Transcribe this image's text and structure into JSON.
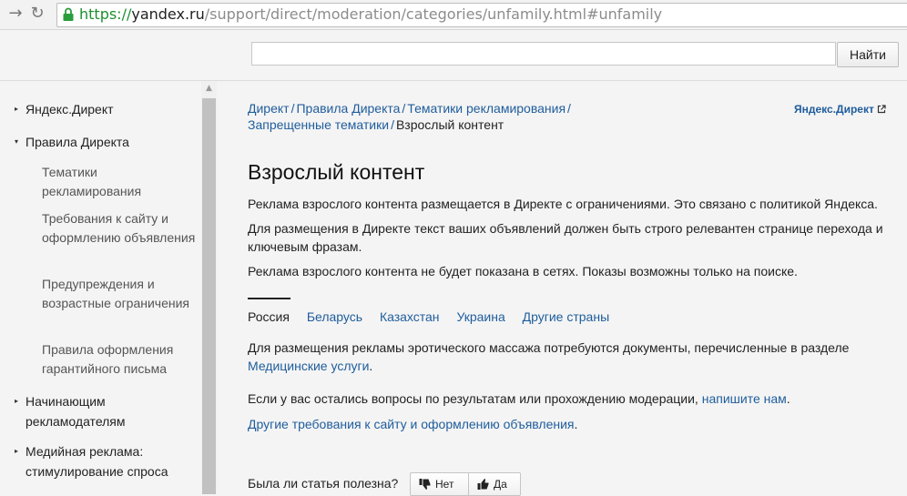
{
  "browser": {
    "url_scheme": "https://",
    "url_host": "yandex.ru",
    "url_path": "/support/direct/moderation/categories/unfamily.html#unfamily"
  },
  "search": {
    "button_label": "Найти",
    "value": ""
  },
  "sidebar": {
    "items": [
      {
        "label": "Яндекс.Директ",
        "expanded": false
      },
      {
        "label": "Правила Директа",
        "expanded": true
      },
      {
        "label": "Начинающим рекламодателям",
        "expanded": false
      },
      {
        "label": "Медийная реклама: стимулирование спроса",
        "expanded": false
      }
    ],
    "subitems": [
      "Тематики рекламирования",
      "Требования к сайту и оформлению объявления",
      "Предупреждения и возрастные ограничения",
      "Правила оформления гарантийного письма"
    ]
  },
  "breadcrumbs": {
    "links": [
      "Директ",
      "Правила Директа",
      "Тематики рекламирования",
      "Запрещенные тематики"
    ],
    "separator": "/",
    "current": "Взрослый контент"
  },
  "header_link": "Яндекс.Директ",
  "article": {
    "title": "Взрослый контент",
    "p1": "Реклама взрослого контента размещается в Директе с ограничениями. Это связано с политикой Яндекса.",
    "p2": "Для размещения в Директе текст ваших объявлений должен быть строго релевантен странице перехода и ключевым фразам.",
    "p3": "Реклама взрослого контента не будет показана в сетях. Показы возможны только на поиске.",
    "tabs": [
      "Россия",
      "Беларусь",
      "Казахстан",
      "Украина",
      "Другие страны"
    ],
    "p4_text": "Для размещения рекламы эротического массажа потребуются документы, перечисленные в разделе",
    "p4_link": "Медицинские услуги",
    "p4_end": ".",
    "p5_text": "Если у вас остались вопросы по результатам или прохождению модерации,",
    "p5_link": "напишите нам",
    "p5_end": ".",
    "p6_link": "Другие требования к сайту и оформлению объявления",
    "p6_end": "."
  },
  "feedback": {
    "question": "Была ли статья полезна?",
    "no_label": "Нет",
    "yes_label": "Да"
  },
  "colors": {
    "link": "#1f5d9c",
    "secure_scheme": "#1c8f2e"
  },
  "icons": {
    "back": "arrow-left-icon",
    "reload": "reload-icon",
    "secure": "lock-icon",
    "external": "external-link-icon",
    "dislike": "thumbs-down-icon",
    "like": "thumbs-up-icon"
  }
}
